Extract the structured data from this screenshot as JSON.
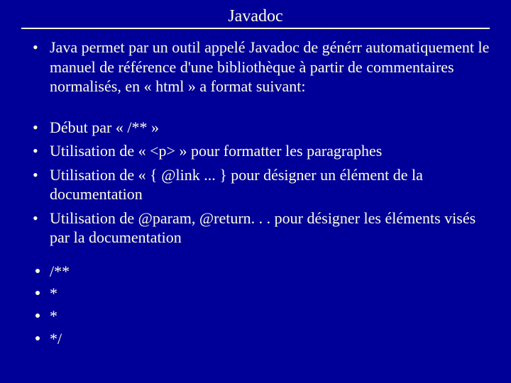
{
  "title": "Javadoc",
  "group1": [
    "Java permet par un outil appelé Javadoc de générr automatiquement le manuel de référence d'une bibliothèque à partir de commentaires normalisés, en « html » a format suivant:"
  ],
  "group2": [
    "Début par « /** »",
    "Utilisation de « <p> » pour formatter les paragraphes",
    "Utilisation de « { @link ... } pour désigner un élément de la documentation",
    "Utilisation de @param, @return. . . pour désigner les éléments visés par la documentation"
  ],
  "code_lines": [
    "/**",
    "*",
    "*",
    "*/"
  ]
}
